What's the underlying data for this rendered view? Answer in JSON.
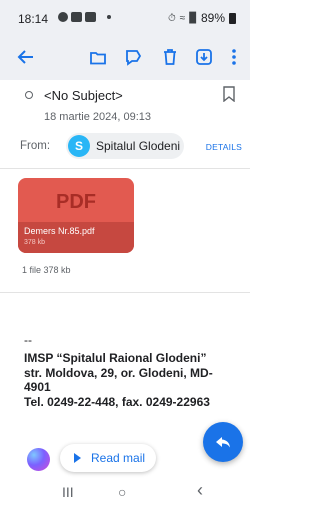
{
  "status_bar": {
    "time": "18:14",
    "battery": "89%"
  },
  "toolbar": {
    "back_icon": "back-arrow-icon",
    "icons": [
      "folder-move-icon",
      "label-icon",
      "trash-icon",
      "download-icon",
      "more-icon"
    ]
  },
  "email": {
    "subject": "<No Subject>",
    "date": "18 martie 2024, 09:13",
    "from_label": "From:",
    "sender_initial": "S",
    "sender_name": "Spitalul Glodeni",
    "details_label": "DETAILS"
  },
  "attachment": {
    "type_label": "PDF",
    "file_name": "Demers  Nr.85.pdf",
    "file_size": "378 kb",
    "summary": "1 file 378 kb"
  },
  "body": {
    "separator": "--",
    "signature_lines": [
      "IMSP “Spitalul Raional Glodeni”",
      "str. Moldova, 29, or. Glodeni, MD-",
      "4901",
      "Tel. 0249-22-448, fax. 0249-22963"
    ]
  },
  "actions": {
    "read_mail_label": "Read mail"
  },
  "nav": {
    "recents": "III",
    "home": "○",
    "back": "‹"
  },
  "colors": {
    "accent": "#1a73e8",
    "pdf": "#e25a50",
    "avatar": "#29b6f6"
  }
}
